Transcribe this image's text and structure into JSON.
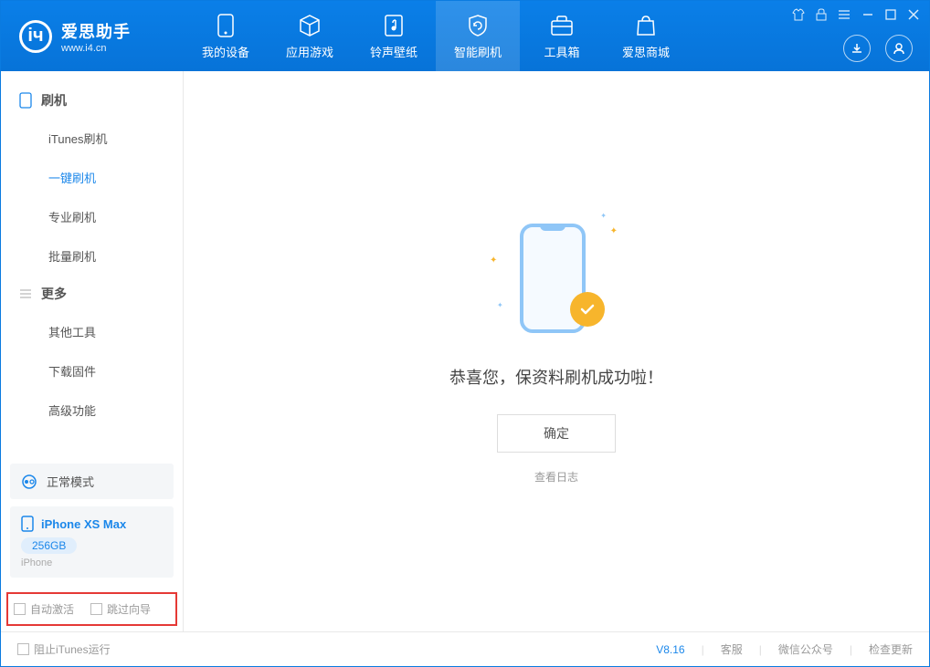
{
  "app": {
    "title": "爱思助手",
    "subtitle": "www.i4.cn"
  },
  "nav": {
    "device": "我的设备",
    "apps": "应用游戏",
    "ringtone": "铃声壁纸",
    "flash": "智能刷机",
    "toolbox": "工具箱",
    "store": "爱思商城"
  },
  "sidebar": {
    "section_flash": "刷机",
    "items_flash": {
      "itunes": "iTunes刷机",
      "onekey": "一键刷机",
      "pro": "专业刷机",
      "batch": "批量刷机"
    },
    "section_more": "更多",
    "items_more": {
      "other": "其他工具",
      "firmware": "下载固件",
      "advanced": "高级功能"
    },
    "mode": "正常模式",
    "device_name": "iPhone XS Max",
    "capacity": "256GB",
    "device_type": "iPhone",
    "opt_activate": "自动激活",
    "opt_skip": "跳过向导"
  },
  "main": {
    "success_text": "恭喜您，保资料刷机成功啦！",
    "ok_btn": "确定",
    "view_log": "查看日志"
  },
  "footer": {
    "block_itunes": "阻止iTunes运行",
    "version": "V8.16",
    "service": "客服",
    "wechat": "微信公众号",
    "update": "检查更新"
  }
}
